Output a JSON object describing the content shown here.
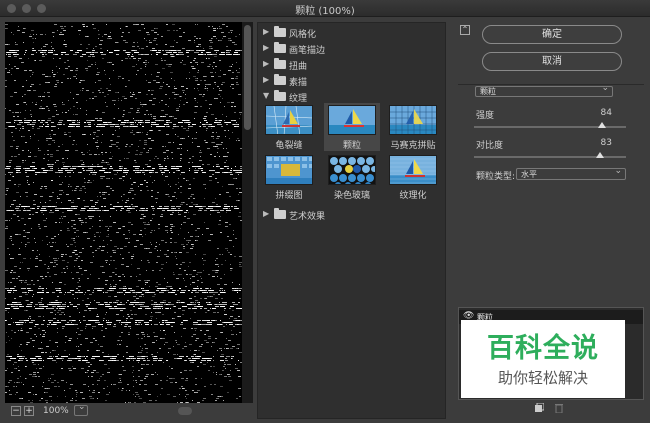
{
  "window": {
    "title": "颗粒 (100%)"
  },
  "preview": {
    "zoom": "100%",
    "zoom_out": "−",
    "zoom_in": "+"
  },
  "gallery": {
    "categories": [
      {
        "label": "风格化",
        "expanded": false
      },
      {
        "label": "画笔描边",
        "expanded": false
      },
      {
        "label": "扭曲",
        "expanded": false
      },
      {
        "label": "素描",
        "expanded": false
      },
      {
        "label": "纹理",
        "expanded": true
      },
      {
        "label": "艺术效果",
        "expanded": false
      }
    ],
    "texture_filters": [
      {
        "label": "龟裂缝",
        "selected": false
      },
      {
        "label": "颗粒",
        "selected": true
      },
      {
        "label": "马赛克拼贴",
        "selected": false
      },
      {
        "label": "拼缀图",
        "selected": false
      },
      {
        "label": "染色玻璃",
        "selected": false
      },
      {
        "label": "纹理化",
        "selected": false
      }
    ]
  },
  "buttons": {
    "ok": "确定",
    "cancel": "取消"
  },
  "settings": {
    "filter": "颗粒",
    "intensity_label": "强度",
    "intensity_value": "84",
    "intensity": 84,
    "contrast_label": "对比度",
    "contrast_value": "83",
    "contrast": 83,
    "grain_type_label": "颗粒类型:",
    "grain_type_value": "水平"
  },
  "layers": {
    "row_label": "颗粒"
  },
  "watermark": {
    "big": "百科全说",
    "small": "助你轻松解决"
  },
  "colors": {
    "accent_green": "#2eae5c",
    "panel": "#3c3c3c",
    "preview_bg": "#000000"
  }
}
